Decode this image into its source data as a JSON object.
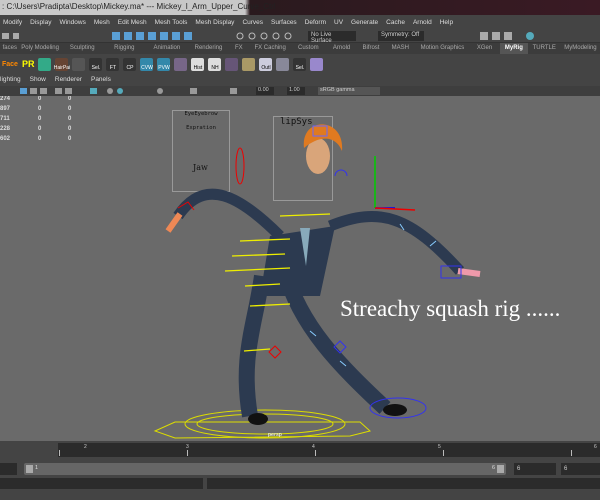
{
  "window": {
    "title": ": C:\\Users\\Pradipta\\Desktop\\Mickey.ma*   ---   Mickey_l_Arm_Upper_Curve_Ctrl"
  },
  "menu": [
    "Modify",
    "Display",
    "Windows",
    "Mesh",
    "Edit Mesh",
    "Mesh Tools",
    "Mesh Display",
    "Curves",
    "Surfaces",
    "Deform",
    "UV",
    "Generate",
    "Cache",
    "Arnold",
    "Help"
  ],
  "toolbar": {
    "live_surface": "No Live Surface",
    "symmetry": "Symmetry: Off"
  },
  "shelf_tabs": [
    "faces",
    "Poly Modeling",
    "Sculpting",
    "Rigging",
    "Animation",
    "Rendering",
    "FX",
    "FX Caching",
    "Custom",
    "Arnold",
    "Bifrost",
    "MASH",
    "Motion Graphics",
    "XGen",
    "MyRig",
    "TURTLE",
    "MyModeling"
  ],
  "active_shelf_tab": "MyRig",
  "shelf_icons": [
    "Face",
    "PR",
    "HairPai",
    "Sel.",
    "FT",
    "CP",
    "CVW",
    "PVW",
    "Hist",
    "NH",
    "Outl",
    "Sel."
  ],
  "panel_menu": [
    "lighting",
    "Show",
    "Renderer",
    "Panels"
  ],
  "panel_toolbar": {
    "exposure": "0.00",
    "gamma": "1.00",
    "color_space": "sRGB gamma"
  },
  "channels": [
    [
      "274",
      "0",
      "0"
    ],
    [
      "897",
      "0",
      "0"
    ],
    [
      "711",
      "0",
      "0"
    ],
    [
      "228",
      "0",
      "0"
    ],
    [
      "602",
      "0",
      "0"
    ]
  ],
  "viewport": {
    "caption": "Streachy squash rig ......",
    "camera": "persp",
    "picker_title": "EyeEyebrow",
    "picker_sub": "Expration",
    "picker_jaw": "Jaw",
    "lip_title": "lipSys"
  },
  "timeline": {
    "ticks": [
      "2",
      "3",
      "4",
      "5",
      "6"
    ]
  },
  "range": {
    "start": "1",
    "end": "6",
    "anim_end": "6",
    "max": "6"
  },
  "colors": {
    "viewport": "#6a6a6a",
    "active_tab": "#555555",
    "accent": "#5a9fd4"
  }
}
